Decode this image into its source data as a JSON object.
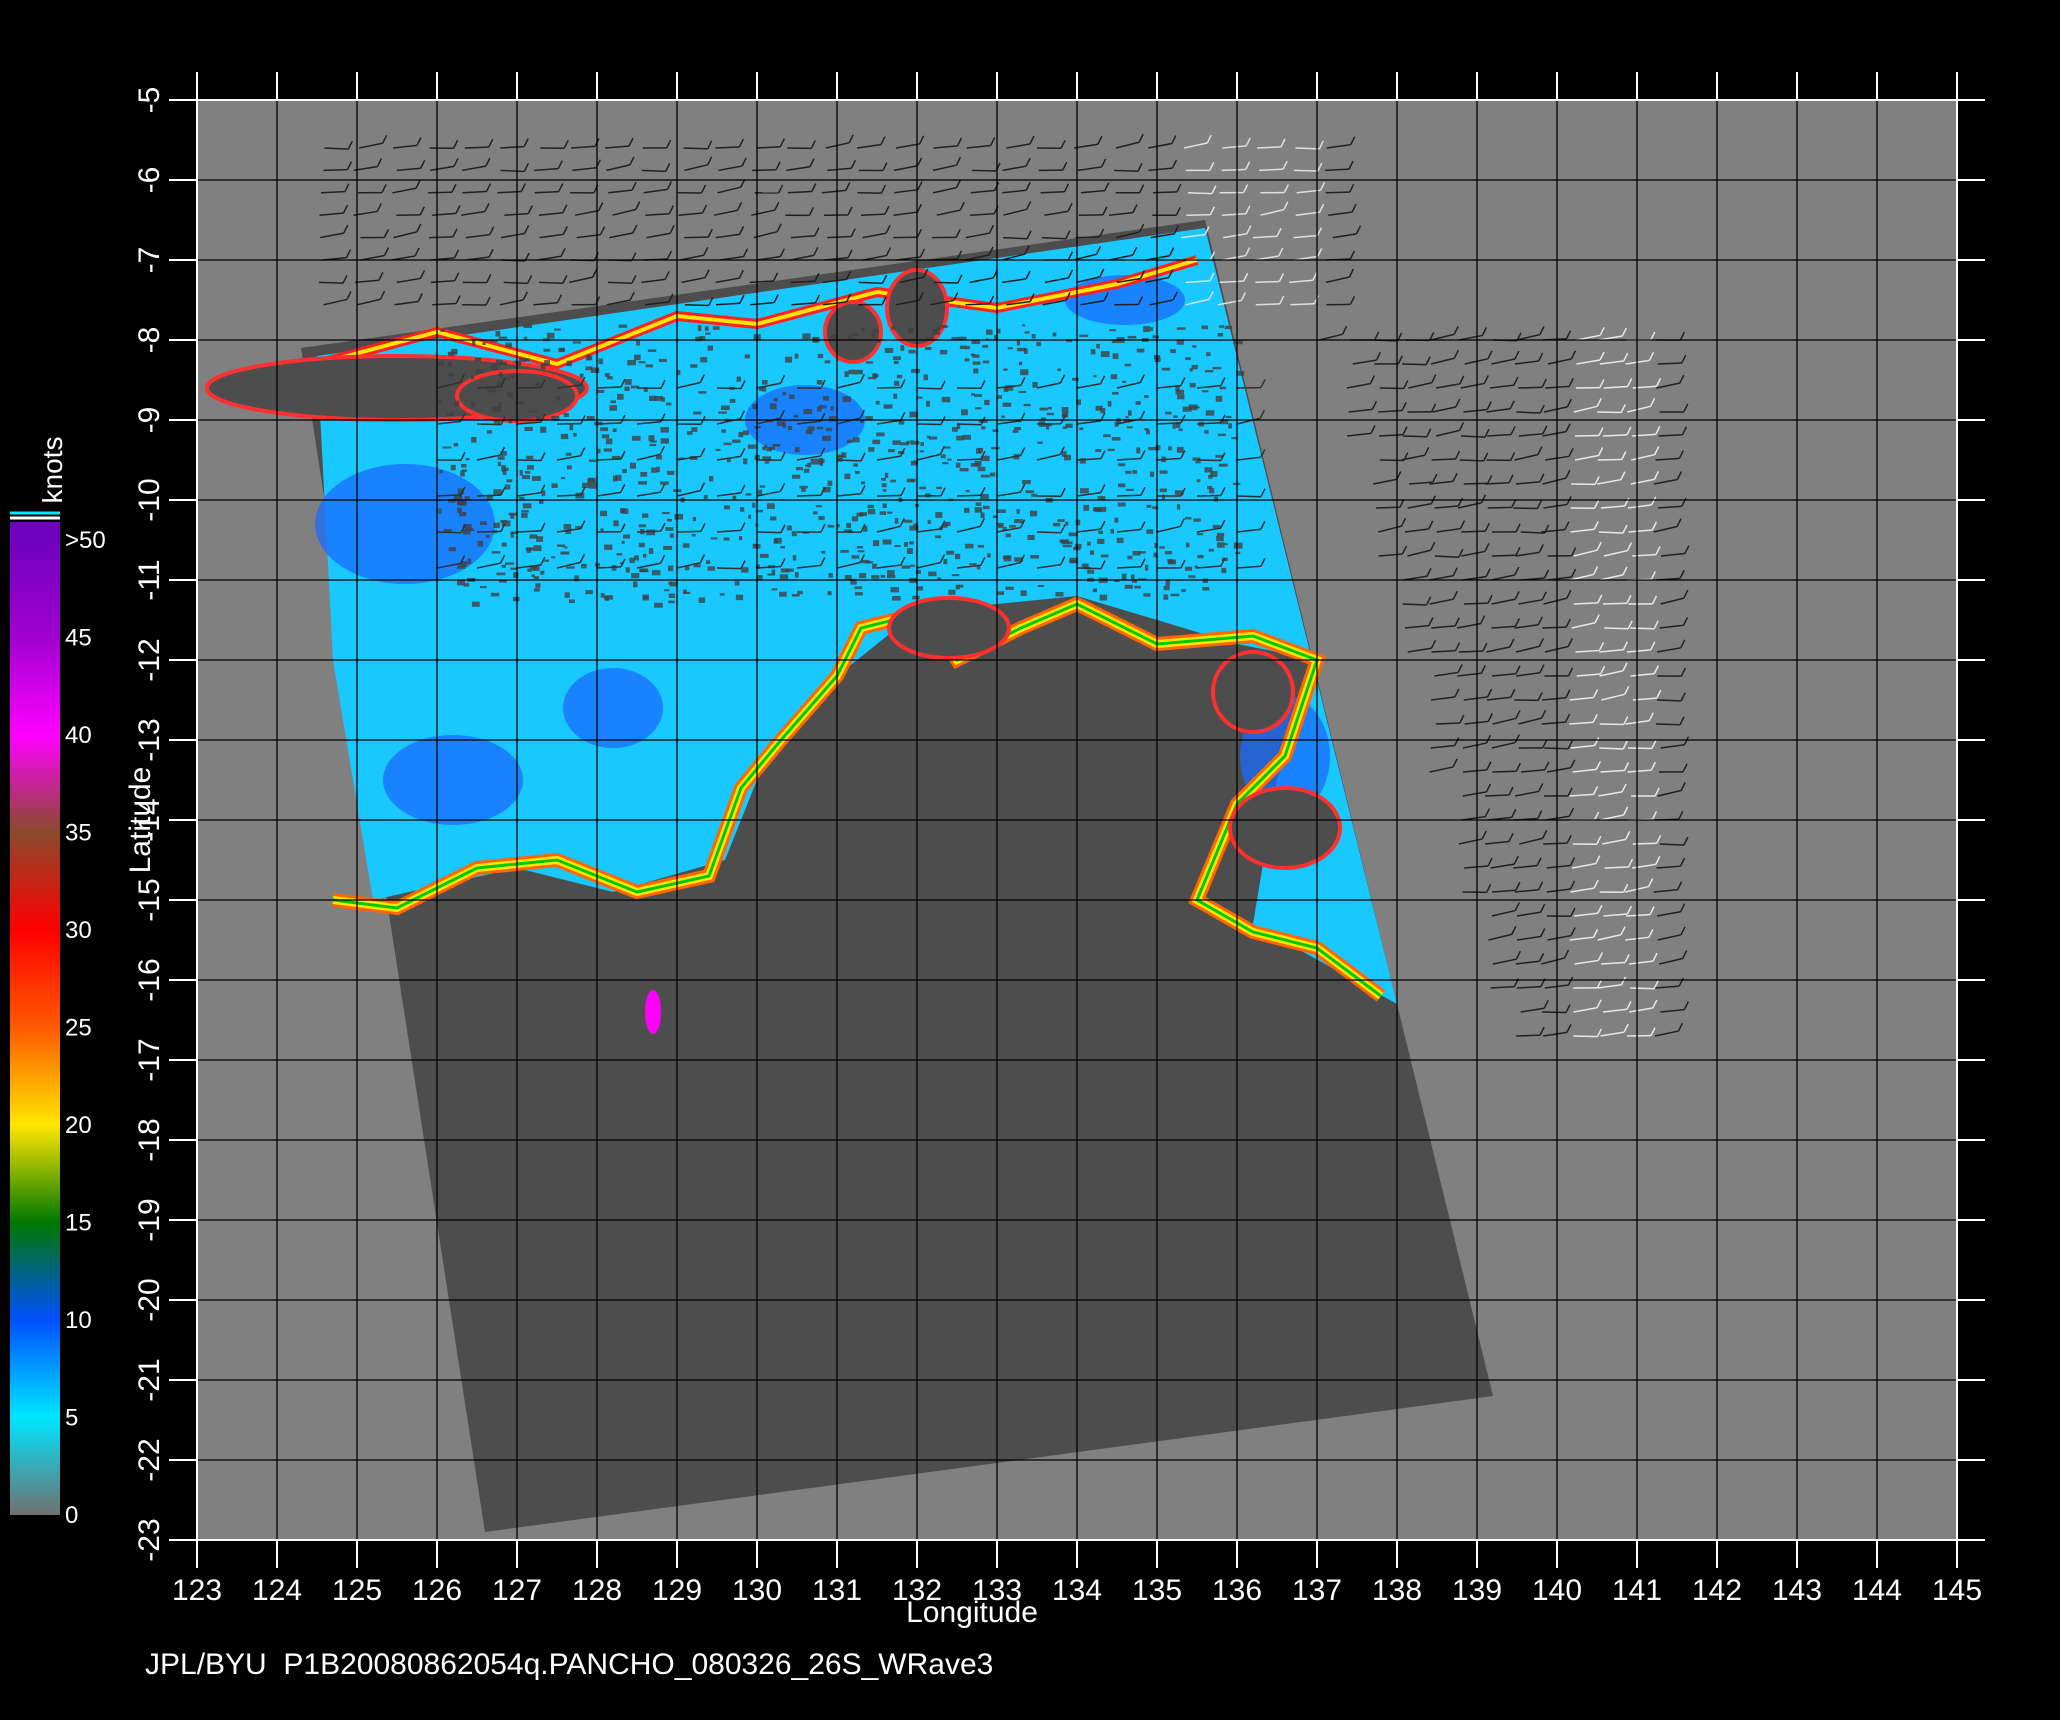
{
  "map": {
    "xlabel": "Longitude",
    "ylabel": "Latitude",
    "lon_range": [
      123,
      145
    ],
    "lat_range": [
      -5,
      -23
    ],
    "lon_ticks": [
      123,
      124,
      125,
      126,
      127,
      128,
      129,
      130,
      131,
      132,
      133,
      134,
      135,
      136,
      137,
      138,
      139,
      140,
      141,
      142,
      143,
      144,
      145
    ],
    "lat_ticks": [
      -5,
      -6,
      -7,
      -8,
      -9,
      -10,
      -11,
      -12,
      -13,
      -14,
      -15,
      -16,
      -17,
      -18,
      -19,
      -20,
      -21,
      -22,
      -23
    ],
    "grid": true,
    "background_color": "#808080",
    "land_color": "#4d4d4d",
    "swath_corners_lonlat": [
      [
        124.3,
        -8.1
      ],
      [
        135.6,
        -6.5
      ],
      [
        139.2,
        -21.2
      ],
      [
        126.6,
        -22.9
      ]
    ],
    "vector_region_lonlat": [
      [
        124.5,
        -6.0
      ],
      [
        137.0,
        -5.8
      ],
      [
        141.0,
        -8.5
      ],
      [
        142.3,
        -11.0
      ],
      [
        141.5,
        -16.0
      ],
      [
        140.5,
        -17.3
      ],
      [
        138.0,
        -16.8
      ]
    ]
  },
  "colorbar": {
    "title": "knots",
    "position": "left",
    "bins": [
      {
        "label": "0",
        "color": "#707070"
      },
      {
        "label": "5",
        "color": "#00e6ff"
      },
      {
        "label": "10",
        "color": "#0050ff"
      },
      {
        "label": "15",
        "color": "#007800"
      },
      {
        "label": "20",
        "color": "#ffe600"
      },
      {
        "label": "25",
        "color": "#ff5a00"
      },
      {
        "label": "30",
        "color": "#ff0000"
      },
      {
        "label": "35",
        "color": "#8a4a2a"
      },
      {
        "label": "40",
        "color": "#ff00ff"
      },
      {
        "label": "45",
        "color": "#a000d0"
      },
      {
        "label": ">50",
        "color": "#7000c0"
      }
    ]
  },
  "footer": {
    "text": "JPL/BYU  P1B20080862054q.PANCHO_080326_26S_WRave3"
  }
}
